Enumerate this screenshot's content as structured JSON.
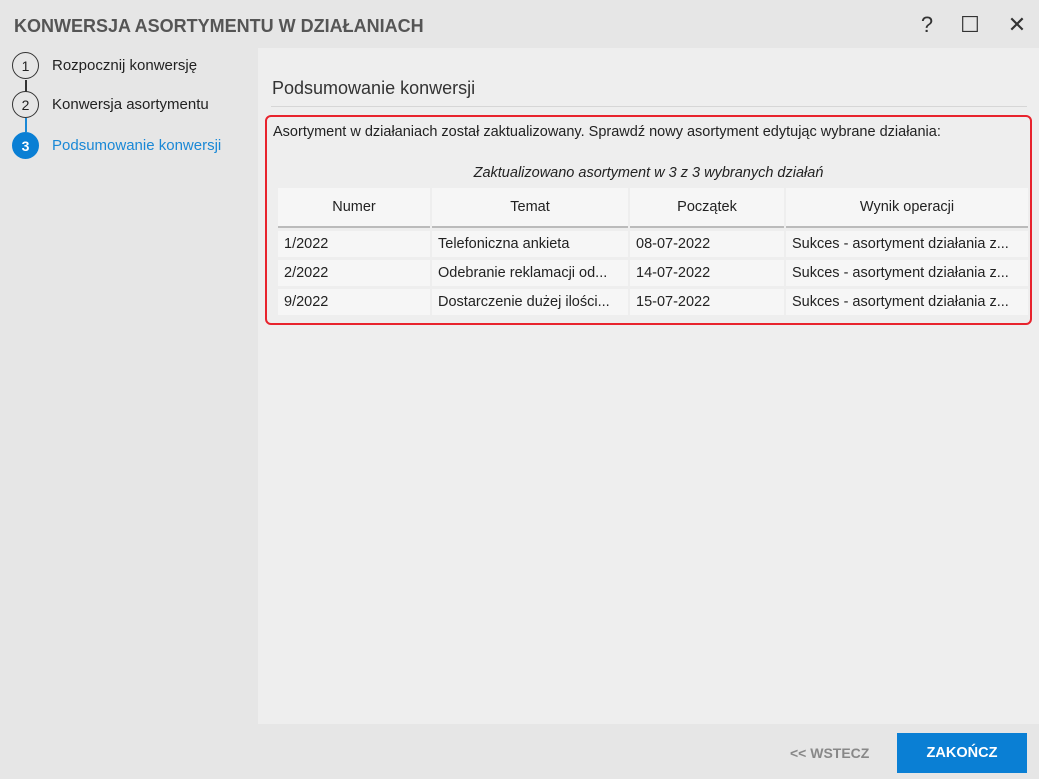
{
  "window": {
    "title": "KONWERSJA ASORTYMENTU W DZIAŁANIACH",
    "help": "?",
    "maximize": "☐",
    "close": "✕"
  },
  "steps": [
    {
      "num": "1",
      "label": "Rozpocznij konwersję"
    },
    {
      "num": "2",
      "label": "Konwersja asortymentu"
    },
    {
      "num": "3",
      "label": "Podsumowanie konwersji"
    }
  ],
  "main": {
    "section_title": "Podsumowanie konwersji",
    "message": "Asortyment w działaniach został zaktualizowany. Sprawdź nowy asortyment edytując wybrane działania:",
    "caption": "Zaktualizowano asortyment w 3 z 3 wybranych działań",
    "columns": [
      "Numer",
      "Temat",
      "Początek",
      "Wynik operacji"
    ],
    "rows": [
      [
        "1/2022",
        "Telefoniczna ankieta",
        "08-07-2022",
        "Sukces - asortyment działania z..."
      ],
      [
        "2/2022",
        "Odebranie reklamacji od...",
        "14-07-2022",
        "Sukces - asortyment działania z..."
      ],
      [
        "9/2022",
        "Dostarczenie dużej ilości...",
        "15-07-2022",
        "Sukces - asortyment działania z..."
      ]
    ]
  },
  "footer": {
    "back": "<< WSTECZ",
    "finish": "ZAKOŃCZ"
  }
}
